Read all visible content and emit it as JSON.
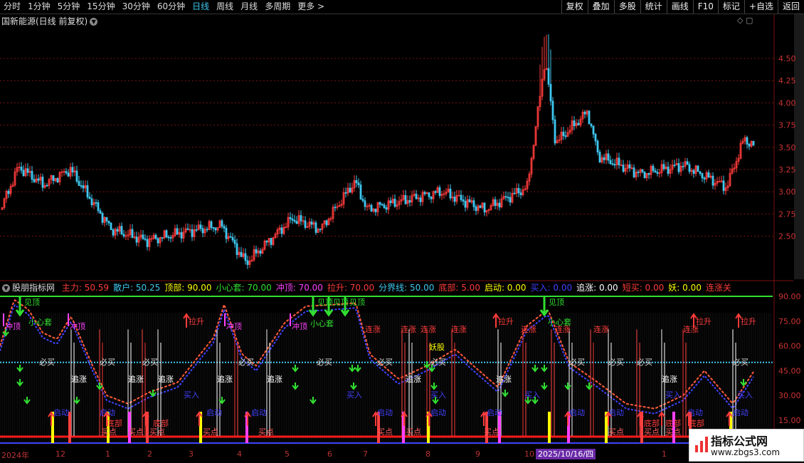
{
  "toolbar": {
    "periods": [
      "分时",
      "1分钟",
      "5分钟",
      "15分钟",
      "30分钟",
      "60分钟",
      "日线",
      "周线",
      "月线",
      "多周期",
      "更多 >"
    ],
    "active_period": "日线",
    "tools": [
      "复权",
      "叠加",
      "多股",
      "统计",
      "画线",
      "F10",
      "标记",
      "+自选",
      "返回"
    ]
  },
  "stock_title": "国新能源(日线 前复权)",
  "price_axis": [
    "4.50",
    "4.25",
    "4.00",
    "3.75",
    "3.50",
    "3.25",
    "3.00",
    "2.75",
    "2.50"
  ],
  "indicator_header": {
    "name": "股朋指标网",
    "items": [
      {
        "label": "主力: 50.59",
        "color": "#ff3b3b"
      },
      {
        "label": "散户: 50.25",
        "color": "#3fc8f0"
      },
      {
        "label": "顶部: 90.00",
        "color": "#ffff00"
      },
      {
        "label": "小心套: 70.00",
        "color": "#31e031"
      },
      {
        "label": "冲顶: 70.00",
        "color": "#ff40ff"
      },
      {
        "label": "拉升: 70.00",
        "color": "#ff3b3b"
      },
      {
        "label": "分界线: 50.00",
        "color": "#3fc8f0"
      },
      {
        "label": "底部: 5.00",
        "color": "#ff3b3b"
      },
      {
        "label": "启动: 0.00",
        "color": "#ffff00"
      },
      {
        "label": "买入: 0.00",
        "color": "#4040ff"
      },
      {
        "label": "追涨: 0.00",
        "color": "#ffffff"
      },
      {
        "label": "短买: 0.00",
        "color": "#ff3b3b"
      },
      {
        "label": "妖: 0.00",
        "color": "#ffff00"
      },
      {
        "label": "连涨关",
        "color": "#ff3b3b"
      }
    ]
  },
  "indicator_axis": [
    "90.00",
    "75.00",
    "60.00",
    "45.00",
    "30.00",
    "15.00"
  ],
  "x_axis_labels": [
    "2024年",
    "12",
    "1",
    "2",
    "3",
    "4",
    "5",
    "6",
    "7",
    "8",
    "9",
    "10",
    "1"
  ],
  "crosshair_date": "2025/10/16/四",
  "signal_labels": {
    "jianding": "见顶",
    "xiaoxintao": "小心套",
    "chongding": "冲顶",
    "lasheng": "拉升",
    "lianzhang": "连涨",
    "zhuizhang": "追涨",
    "maidian": "买点",
    "qidong": "启动",
    "mairu": "买入",
    "dibu": "底部",
    "yaogu": "妖股",
    "zhongyao": "必买"
  },
  "watermark": {
    "line1": "指标公式网",
    "line2": "www.zbgs3.com"
  },
  "colors": {
    "up": "#ff3b3b",
    "down": "#3fc8f0",
    "grid": "#7a1010",
    "green": "#31e031",
    "yellow": "#ffff00",
    "magenta": "#ff40ff",
    "blue": "#4040ff"
  }
}
